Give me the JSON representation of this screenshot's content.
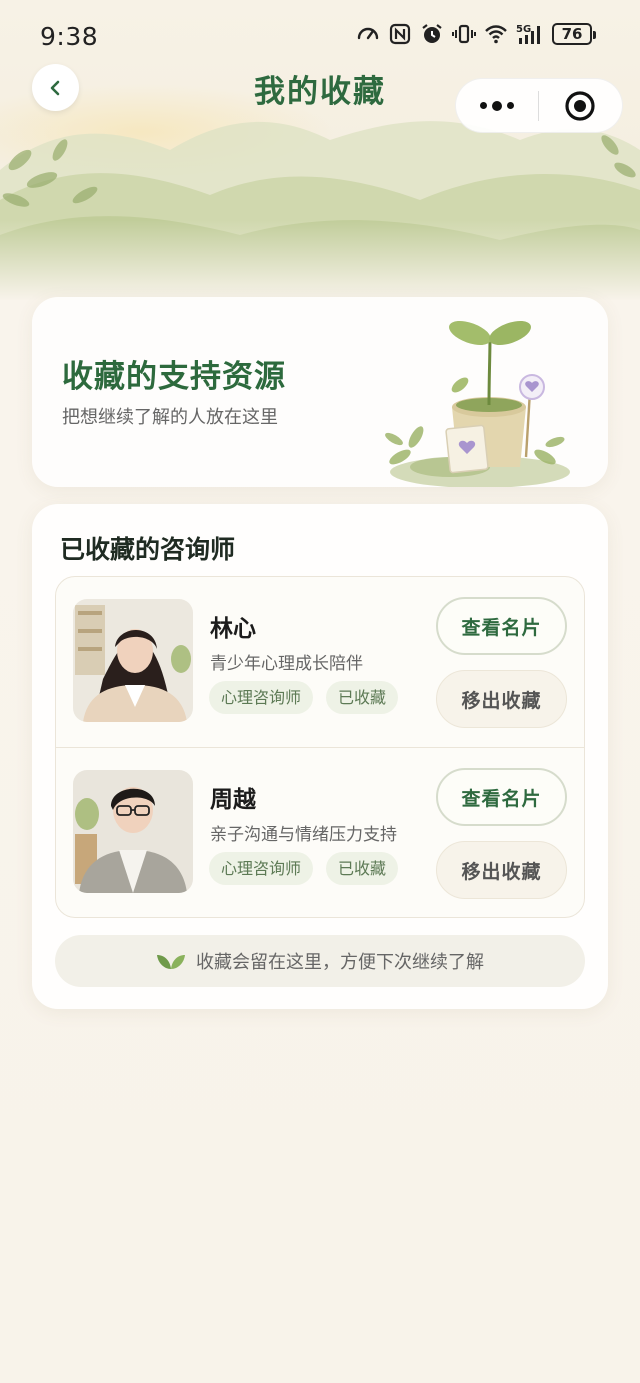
{
  "status_bar": {
    "time": "9:38",
    "battery": "76",
    "icons": [
      "speedometer-icon",
      "nfc-icon",
      "alarm-icon",
      "vibrate-icon",
      "wifi-icon",
      "5g-signal-icon",
      "battery-icon"
    ]
  },
  "nav": {
    "title": "我的收藏",
    "back_icon": "chevron-left-icon",
    "more_icon": "more-dots-icon",
    "close_icon": "target-icon"
  },
  "intro": {
    "title": "收藏的支持资源",
    "subtitle": "把想继续了解的人放在这里"
  },
  "favorites": {
    "section_title": "已收藏的咨询师",
    "items": [
      {
        "name": "林心",
        "description": "青少年心理成长陪伴",
        "tags": [
          "心理咨询师",
          "已收藏"
        ],
        "view_label": "查看名片",
        "remove_label": "移出收藏"
      },
      {
        "name": "周越",
        "description": "亲子沟通与情绪压力支持",
        "tags": [
          "心理咨询师",
          "已收藏"
        ],
        "view_label": "查看名片",
        "remove_label": "移出收藏"
      }
    ]
  },
  "hint": {
    "text": "收藏会留在这里，方便下次继续了解",
    "icon": "leaf-icon"
  },
  "colors": {
    "accent_green": "#2e6a3f",
    "tag_bg": "#eef2e6",
    "background": "#f8f3ea"
  }
}
